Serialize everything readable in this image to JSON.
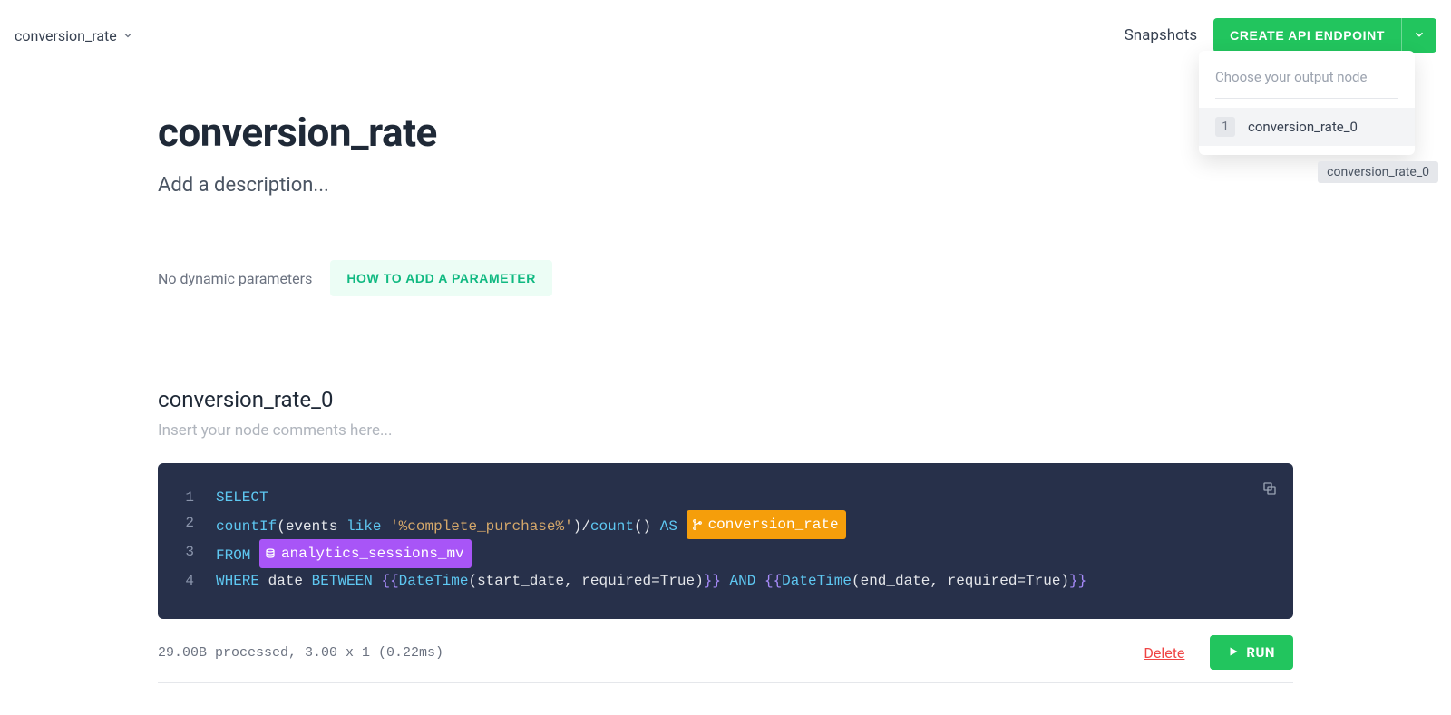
{
  "header": {
    "breadcrumb": "conversion_rate",
    "snapshots_label": "Snapshots",
    "create_button": "CREATE API ENDPOINT"
  },
  "dropdown": {
    "heading": "Choose your output node",
    "items": [
      {
        "num": "1",
        "label": "conversion_rate_0"
      }
    ],
    "tooltip": "conversion_rate_0"
  },
  "page": {
    "title": "conversion_rate",
    "description_placeholder": "Add a description...",
    "params_text": "No dynamic parameters",
    "params_button": "HOW TO ADD A PARAMETER"
  },
  "node": {
    "title": "conversion_rate_0",
    "comments_placeholder": "Insert your node comments here...",
    "code": {
      "line1": {
        "num": "1",
        "kw": "SELECT"
      },
      "line2": {
        "num": "2",
        "indent": "  ",
        "fn": "countIf",
        "open": "(",
        "arg1": "events ",
        "like": "like",
        "space1": " ",
        "str": "'%complete_purchase%'",
        "close": ")",
        "slash": "/",
        "fn2": "count",
        "paren2": "()",
        "space2": " ",
        "as": "AS",
        "space3": " ",
        "badge": "conversion_rate"
      },
      "line3": {
        "num": "3",
        "from": "FROM",
        "space": " ",
        "badge": "analytics_sessions_mv"
      },
      "line4": {
        "num": "4",
        "where": "WHERE",
        "s1": " ",
        "date": "date",
        "s2": " ",
        "between": "BETWEEN",
        "s3": " ",
        "br_open1": "{{",
        "dt1": "DateTime",
        "args1": "(start_date, required=True)",
        "br_close1": "}}",
        "s4": " ",
        "and": "AND",
        "s5": " ",
        "br_open2": "{{",
        "dt2": "DateTime",
        "args2": "(end_date, required=True)",
        "br_close2": "}}"
      }
    }
  },
  "footer": {
    "stats": "29.00B processed, 3.00 x 1 (0.22ms)",
    "delete": "Delete",
    "run": "RUN"
  }
}
